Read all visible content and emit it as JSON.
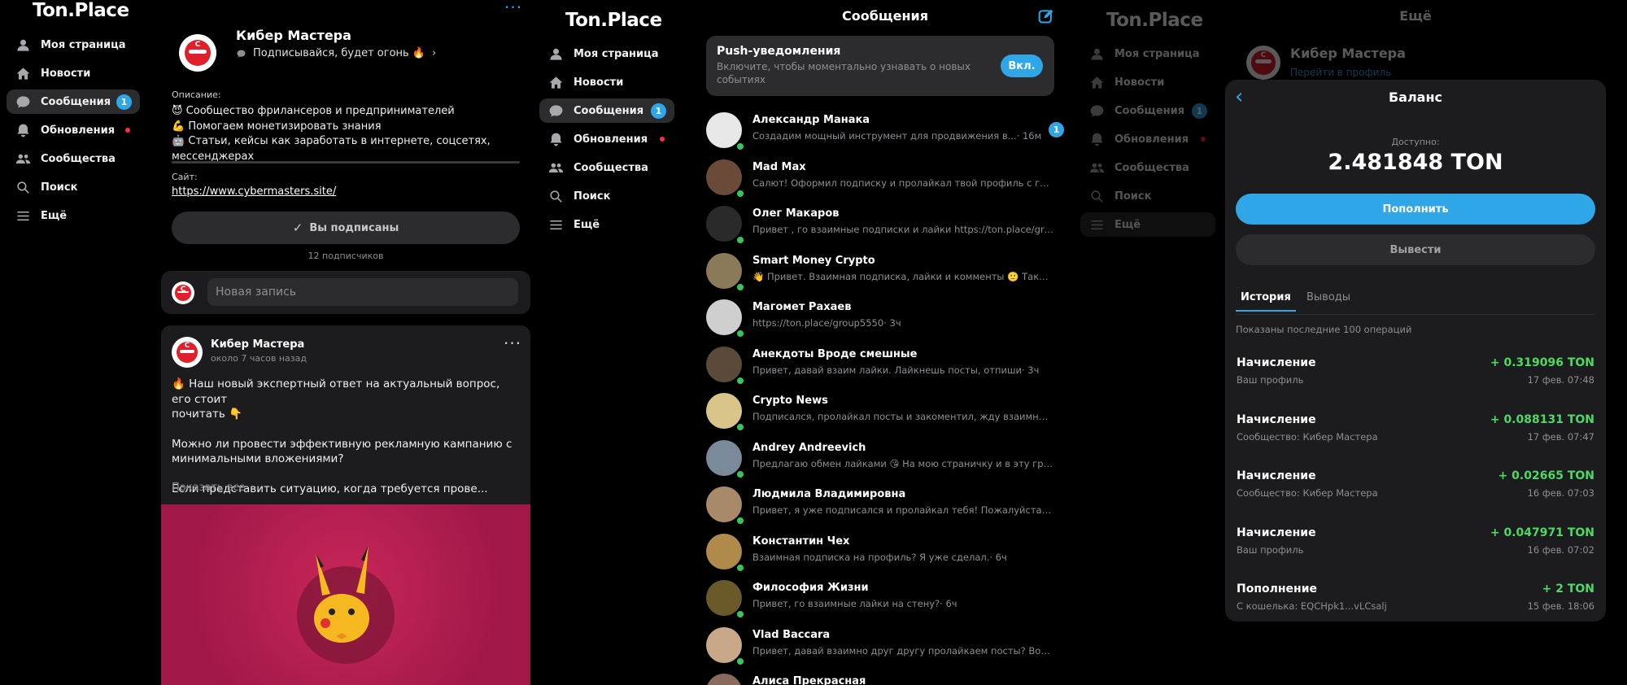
{
  "logo": "Ton.Place",
  "nav": [
    {
      "label": "Моя страница",
      "icon": "user-icon"
    },
    {
      "label": "Новости",
      "icon": "home-icon"
    },
    {
      "label": "Сообщения",
      "icon": "chat-icon",
      "badge": "1"
    },
    {
      "label": "Обновления",
      "icon": "bell-icon"
    },
    {
      "label": "Сообщества",
      "icon": "users-icon"
    },
    {
      "label": "Поиск",
      "icon": "search-icon"
    },
    {
      "label": "Ещё",
      "icon": "menu-icon"
    }
  ],
  "community": {
    "name": "Кибер Мастера",
    "status": "Подписывайся, будет огонь 🔥",
    "description_label": "Описание:",
    "description_lines": [
      "😈 Сообщество фрилансеров и предпринимателей",
      "💪 Помогаем монетизировать знания",
      "🤖 Статьи, кейсы как заработать в интернете, соцсетях,",
      "мессенджерах"
    ],
    "site_label": "Сайт:",
    "site_url": "https://www.cybermasters.site/",
    "subscribed_label": "Вы подписаны",
    "subscribers": "12 подписчиков",
    "new_post_placeholder": "Новая запись"
  },
  "post": {
    "author": "Кибер Мастера",
    "time": "около 7 часов назад",
    "text1": "🔥 Наш новый экспертный ответ на актуальный вопрос, его стоит",
    "text2": "почитать 👇",
    "text3": "Можно ли провести эффективную рекламную кампанию с",
    "text4": "минимальными вложениями?",
    "text5": "Если представить ситуацию, когда требуется прове...",
    "show_all": "Показать все"
  },
  "messages": {
    "title": "Сообщения",
    "push": {
      "title": "Push-уведомления",
      "text1": "Включите, чтобы моментально узнавать о новых",
      "text2": "событиях",
      "button": "Вкл."
    },
    "chats": [
      {
        "name": "Александр Манака",
        "msg": "Создадим мощный инструмент для продвижения в...",
        "time": "· 16м",
        "unread": "1",
        "color": "#e8e8e8"
      },
      {
        "name": "Mad Max",
        "msg": "Салют! Оформил подписку и пролайкал твой профиль с гру...",
        "time": "· 1ч",
        "color": "#6b4a3a"
      },
      {
        "name": "Олег Макаров",
        "msg": "Привет , го взаимные подписки и лайки https://ton.place/grou...",
        "time": "· 2ч",
        "color": "#2a2a2a"
      },
      {
        "name": "Smart Money Crypto",
        "msg": "👋 Привет. Взаимная подписка, лайки и комменты 🙂 Такж...",
        "time": "· 3ч",
        "color": "#8a7a5a"
      },
      {
        "name": "Магомет Рахаев",
        "msg": "https://ton.place/group5550",
        "time": "· 3ч",
        "color": "#cfcfcf"
      },
      {
        "name": "Анекдоты Вроде смешные",
        "msg": "Привет, давай взаим лайки. Лайкнешь посты, отпиши",
        "time": "· 3ч",
        "color": "#5a4a3a"
      },
      {
        "name": "Crypto News",
        "msg": "Подписался, пролайкал посты и закоментил, жду взаимност...",
        "time": "· 3ч",
        "color": "#d9c48a"
      },
      {
        "name": "Andrey Andreevich",
        "msg": "Предлагаю обмен лайками 😘 На мою страничку и в эту гру...",
        "time": "· 3ч",
        "color": "#7a8a9a"
      },
      {
        "name": "Людмила Владимировна",
        "msg": "Привет, я уже подписался и пролайкал тебя! Пожалуйста, с...",
        "time": "· 6ч",
        "color": "#a88a6a"
      },
      {
        "name": "Константин Чех",
        "msg": "Взаимная подписка на профиль? Я уже сделал.",
        "time": "· 6ч",
        "color": "#b08a4a"
      },
      {
        "name": "Философия Жизни",
        "msg": "Привет, го взаимные лайки на стену?",
        "time": "· 6ч",
        "color": "#6a5a2a"
      },
      {
        "name": "Vlad Baccara",
        "msg": "Привет, давай взаимно друг другу пролайкаем посты? Вот ...",
        "time": "· 6ч",
        "color": "#c8a888"
      },
      {
        "name": "Алиса Прекрасная",
        "msg": "",
        "time": "",
        "color": "#8a6a5a"
      }
    ]
  },
  "more": {
    "title": "Ещё",
    "profile_name": "Кибер Мастера",
    "profile_link": "Перейти в профиль"
  },
  "balance": {
    "title": "Баланс",
    "available_label": "Доступно:",
    "amount": "2.481848 TON",
    "topup": "Пополнить",
    "withdraw": "Вывести",
    "tabs": [
      "История",
      "Выводы"
    ],
    "note": "Показаны последние 100 операций",
    "transactions": [
      {
        "title": "Начисление",
        "source": "Ваш профиль",
        "amount": "+ 0.319096 TON",
        "date": "17 фев. 07:48"
      },
      {
        "title": "Начисление",
        "source": "Сообщество: Кибер Мастера",
        "amount": "+ 0.088131 TON",
        "date": "17 фев. 07:47"
      },
      {
        "title": "Начисление",
        "source": "Сообщество: Кибер Мастера",
        "amount": "+ 0.02665 TON",
        "date": "16 фев. 07:03"
      },
      {
        "title": "Начисление",
        "source": "Ваш профиль",
        "amount": "+ 0.047971 TON",
        "date": "16 фев. 07:02"
      },
      {
        "title": "Пополнение",
        "source": "С кошелька: EQCHpk1...vLCsalj",
        "amount": "+ 2 TON",
        "date": "15 фев. 18:06"
      }
    ]
  }
}
